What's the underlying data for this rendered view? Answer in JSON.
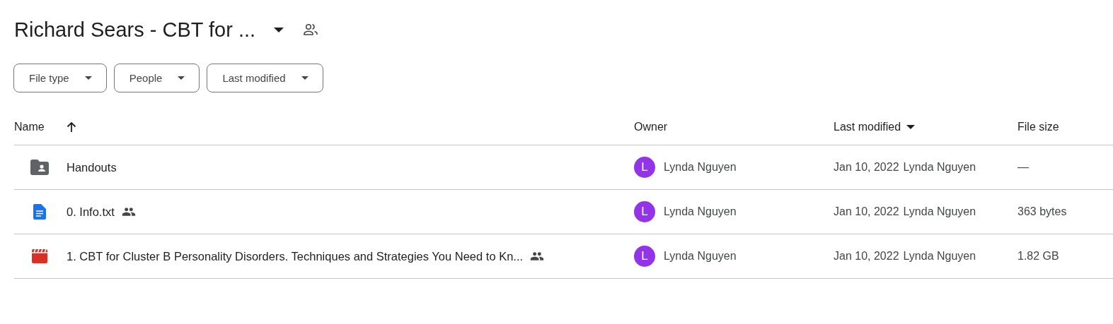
{
  "folder": {
    "title": "Richard Sears - CBT for ...",
    "shared": true
  },
  "filters": [
    {
      "label": "File type"
    },
    {
      "label": "People"
    },
    {
      "label": "Last modified"
    }
  ],
  "table": {
    "columns": [
      {
        "label": "Name",
        "sorted": true,
        "descending": false
      },
      {
        "label": "Owner",
        "sorted": false
      },
      {
        "label": "Last modified",
        "sorted": true,
        "descending": true
      },
      {
        "label": "File size",
        "sorted": false
      }
    ],
    "rows": [
      {
        "kind": "folder",
        "name": "Handouts",
        "shared": false,
        "owner_initial": "L",
        "owner": "Lynda Nguyen",
        "modified_date": "Jan 10, 2022",
        "modified_by": "Lynda Nguyen",
        "size": "—"
      },
      {
        "kind": "document",
        "name": "0. Info.txt",
        "shared": true,
        "owner_initial": "L",
        "owner": "Lynda Nguyen",
        "modified_date": "Jan 10, 2022",
        "modified_by": "Lynda Nguyen",
        "size": "363 bytes"
      },
      {
        "kind": "video",
        "name": "1. CBT for Cluster B Personality Disorders.  Techniques and Strategies You Need to Kn...",
        "shared": true,
        "owner_initial": "L",
        "owner": "Lynda Nguyen",
        "modified_date": "Jan 10, 2022",
        "modified_by": "Lynda Nguyen",
        "size": "1.82 GB"
      }
    ]
  }
}
